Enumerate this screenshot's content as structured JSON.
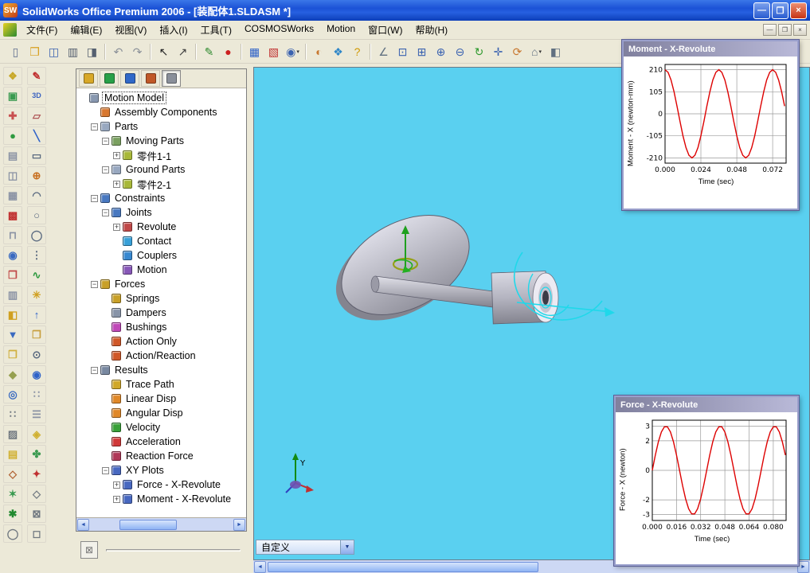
{
  "colors": {
    "viewport-bg": "#5ad0f0",
    "curve": "#dd0000",
    "titlebar-blue": "#1b52d6",
    "xp-beige": "#ece9d8"
  },
  "window": {
    "title": "SolidWorks Office Premium 2006 - [装配体1.SLDASM *]",
    "logo": "SW",
    "buttons": [
      {
        "name": "minimize",
        "glyph": "—"
      },
      {
        "name": "restore",
        "glyph": "❐"
      },
      {
        "name": "close",
        "glyph": "×"
      }
    ]
  },
  "menubar": {
    "items": [
      "文件(F)",
      "编辑(E)",
      "视图(V)",
      "插入(I)",
      "工具(T)",
      "COSMOSWorks",
      "Motion",
      "窗口(W)",
      "帮助(H)"
    ],
    "window_buttons": [
      {
        "name": "mdi-minimize",
        "glyph": "—"
      },
      {
        "name": "mdi-restore",
        "glyph": "❐"
      },
      {
        "name": "mdi-close",
        "glyph": "×"
      }
    ]
  },
  "toolbar": {
    "items": [
      {
        "name": "new-document",
        "glyph": "▯",
        "color": "#607090"
      },
      {
        "name": "open-document",
        "glyph": "❒",
        "color": "#d8a020"
      },
      {
        "name": "save",
        "glyph": "◫",
        "color": "#3a62b0"
      },
      {
        "name": "print",
        "glyph": "▥",
        "color": "#556070"
      },
      {
        "name": "print-preview",
        "glyph": "◨",
        "color": "#556070"
      },
      {
        "sep": true
      },
      {
        "name": "undo",
        "glyph": "↶",
        "color": "#8a9098"
      },
      {
        "name": "redo",
        "glyph": "↷",
        "color": "#8a9098"
      },
      {
        "sep": true
      },
      {
        "name": "select",
        "glyph": "↖",
        "color": "#202020"
      },
      {
        "name": "select-other",
        "glyph": "↗",
        "color": "#404040"
      },
      {
        "sep": true
      },
      {
        "name": "sketch",
        "glyph": "✎",
        "color": "#2e8a2e"
      },
      {
        "name": "sketch-point",
        "glyph": "●",
        "color": "#cc2020"
      },
      {
        "sep": true
      },
      {
        "name": "grid",
        "glyph": "▦",
        "color": "#2e62c8"
      },
      {
        "name": "options-panel",
        "glyph": "▧",
        "color": "#c03030"
      },
      {
        "name": "view-orientation",
        "glyph": "◉",
        "color": "#3a62b0",
        "dropdown": true
      },
      {
        "sep": true
      },
      {
        "name": "screen-capture",
        "glyph": "◐",
        "color": "#c87830"
      },
      {
        "name": "assembly-tools",
        "glyph": "❖",
        "color": "#2e86c8"
      },
      {
        "name": "help",
        "glyph": "?",
        "color": "#d09800"
      },
      {
        "sep": true
      },
      {
        "name": "measure",
        "glyph": "∠",
        "color": "#607080"
      },
      {
        "name": "zoom-to-fit",
        "glyph": "⊡",
        "color": "#3a62b0"
      },
      {
        "name": "zoom-to-area",
        "glyph": "⊞",
        "color": "#3a62b0"
      },
      {
        "name": "zoom-in-out",
        "glyph": "⊕",
        "color": "#3a62b0"
      },
      {
        "name": "zoom-out",
        "glyph": "⊖",
        "color": "#3a62b0"
      },
      {
        "name": "refresh-view",
        "glyph": "↻",
        "color": "#2e9a2e"
      },
      {
        "name": "pan",
        "glyph": "✛",
        "color": "#3a62b0"
      },
      {
        "name": "rotate-view",
        "glyph": "⟳",
        "color": "#c87830"
      },
      {
        "name": "standard-views",
        "glyph": "⌂",
        "color": "#607080",
        "dropdown": true
      },
      {
        "name": "display-style",
        "glyph": "◧",
        "color": "#607080"
      }
    ]
  },
  "left_toolbar_a": {
    "items": [
      {
        "name": "assembly-tool-1",
        "glyph": "❖",
        "color": "#c8a828"
      },
      {
        "name": "assembly-tool-2",
        "glyph": "▣",
        "color": "#3a9a50"
      },
      {
        "name": "assembly-tool-3",
        "glyph": "✚",
        "color": "#c85050"
      },
      {
        "name": "assembly-tool-4",
        "glyph": "●",
        "color": "#2f9a40"
      },
      {
        "name": "assembly-tool-5",
        "glyph": "▤",
        "color": "#8a92a4"
      },
      {
        "name": "assembly-tool-6",
        "glyph": "◫",
        "color": "#8a92a4"
      },
      {
        "name": "assembly-tool-7",
        "glyph": "▦",
        "color": "#8a92a4"
      },
      {
        "name": "assembly-tool-8",
        "glyph": "▩",
        "color": "#c03030"
      },
      {
        "name": "assembly-tool-9",
        "glyph": "⊓",
        "color": "#8a92a4"
      },
      {
        "name": "assembly-tool-10",
        "glyph": "◉",
        "color": "#3a6ac0"
      },
      {
        "name": "assembly-tool-11",
        "glyph": "❐",
        "color": "#c04848"
      },
      {
        "name": "assembly-tool-12",
        "glyph": "▥",
        "color": "#8a92a4"
      },
      {
        "name": "assembly-tool-13",
        "glyph": "◧",
        "color": "#d0a020"
      },
      {
        "name": "assembly-tool-14",
        "glyph": "▼",
        "color": "#3a6ac0"
      },
      {
        "name": "assembly-tool-15",
        "glyph": "❒",
        "color": "#d0b040"
      },
      {
        "name": "assembly-tool-16",
        "glyph": "◆",
        "color": "#96a050"
      },
      {
        "name": "assembly-tool-17",
        "glyph": "◎",
        "color": "#3a6ac0"
      },
      {
        "name": "assembly-tool-18",
        "glyph": "∷",
        "color": "#707880"
      },
      {
        "name": "assembly-tool-19",
        "glyph": "▨",
        "color": "#707880"
      },
      {
        "name": "assembly-tool-20",
        "glyph": "▤",
        "color": "#d0b030"
      },
      {
        "name": "assembly-tool-21",
        "glyph": "◇",
        "color": "#b06030"
      },
      {
        "name": "assembly-tool-22",
        "glyph": "✶",
        "color": "#3a9a50"
      },
      {
        "name": "assembly-tool-23",
        "glyph": "✱",
        "color": "#228a30"
      },
      {
        "name": "assembly-tool-24",
        "glyph": "◯",
        "color": "#707880"
      }
    ]
  },
  "left_toolbar_b": {
    "items": [
      {
        "name": "sketch-tool-1",
        "glyph": "✎",
        "color": "#c03030"
      },
      {
        "name": "sketch-tool-2",
        "glyph": "3D",
        "color": "#3a62c0"
      },
      {
        "name": "sketch-tool-3",
        "glyph": "▱",
        "color": "#b05858"
      },
      {
        "name": "sketch-tool-4",
        "glyph": "╲",
        "color": "#2e62c8"
      },
      {
        "name": "sketch-tool-5",
        "glyph": "▭",
        "color": "#5a6a80"
      },
      {
        "name": "sketch-tool-6",
        "glyph": "⊕",
        "color": "#c87020"
      },
      {
        "name": "sketch-tool-7",
        "glyph": "◠",
        "color": "#5a6a80"
      },
      {
        "name": "sketch-tool-8",
        "glyph": "○",
        "color": "#5a6a80"
      },
      {
        "name": "sketch-tool-9",
        "glyph": "◯",
        "color": "#5a6a80"
      },
      {
        "name": "sketch-tool-10",
        "glyph": "⋮",
        "color": "#5a6a80"
      },
      {
        "name": "sketch-tool-11",
        "glyph": "∿",
        "color": "#2f9a40"
      },
      {
        "name": "sketch-tool-12",
        "glyph": "✳",
        "color": "#d0a020"
      },
      {
        "name": "sketch-tool-13",
        "glyph": "↑",
        "color": "#2e62c8"
      },
      {
        "name": "sketch-tool-14",
        "glyph": "❒",
        "color": "#c8a040"
      },
      {
        "name": "sketch-tool-15",
        "glyph": "⊙",
        "color": "#5a6a80"
      },
      {
        "name": "sketch-tool-16",
        "glyph": "◉",
        "color": "#2e62c8"
      },
      {
        "name": "sketch-tool-17",
        "glyph": "∷",
        "color": "#8a92a4"
      },
      {
        "name": "sketch-tool-18",
        "glyph": "☰",
        "color": "#8a92a4"
      },
      {
        "name": "sketch-tool-19",
        "glyph": "◈",
        "color": "#d0b030"
      },
      {
        "name": "sketch-tool-20",
        "glyph": "✤",
        "color": "#3a9a50"
      },
      {
        "name": "sketch-tool-21",
        "glyph": "✦",
        "color": "#c03030"
      },
      {
        "name": "sketch-tool-22",
        "glyph": "◇",
        "color": "#707880"
      },
      {
        "name": "sketch-tool-23",
        "glyph": "⊠",
        "color": "#707880"
      },
      {
        "name": "sketch-tool-24",
        "glyph": "◻",
        "color": "#707880"
      }
    ]
  },
  "tree": {
    "tabs": [
      {
        "name": "featuremanager",
        "color": "#d8a828"
      },
      {
        "name": "propertymanager",
        "color": "#28a048"
      },
      {
        "name": "configurationmanager",
        "color": "#3068c8"
      },
      {
        "name": "cosmos",
        "color": "#c05828"
      },
      {
        "name": "motionmanager",
        "color": "#8a8f9a",
        "selected": true
      }
    ],
    "items": [
      {
        "label": "Motion Model",
        "depth": 0,
        "expand": "none",
        "icon": "motion-model",
        "color": "#8898b0",
        "selected": true
      },
      {
        "label": "Assembly Components",
        "depth": 1,
        "expand": "none",
        "icon": "assembly-components",
        "color": "#d87830"
      },
      {
        "label": "Parts",
        "depth": 1,
        "expand": "minus",
        "icon": "parts",
        "color": "#98a8c0"
      },
      {
        "label": "Moving Parts",
        "depth": 2,
        "expand": "minus",
        "icon": "moving-parts",
        "color": "#7aa060"
      },
      {
        "label": "零件1-1",
        "depth": 3,
        "expand": "plus",
        "icon": "part",
        "color": "#a8b838"
      },
      {
        "label": "Ground Parts",
        "depth": 2,
        "expand": "minus",
        "icon": "ground-parts",
        "color": "#98a8c0"
      },
      {
        "label": "零件2-1",
        "depth": 3,
        "expand": "plus",
        "icon": "part",
        "color": "#a8b838"
      },
      {
        "label": "Constraints",
        "depth": 1,
        "expand": "minus",
        "icon": "constraints",
        "color": "#4878c0"
      },
      {
        "label": "Joints",
        "depth": 2,
        "expand": "minus",
        "icon": "joints",
        "color": "#4878c0"
      },
      {
        "label": "Revolute",
        "depth": 3,
        "expand": "plus",
        "icon": "revolute",
        "color": "#c04848"
      },
      {
        "label": "Contact",
        "depth": 3,
        "expand": "none",
        "icon": "contact",
        "color": "#38a0d8"
      },
      {
        "label": "Couplers",
        "depth": 3,
        "expand": "none",
        "icon": "couplers",
        "color": "#3888d0"
      },
      {
        "label": "Motion",
        "depth": 3,
        "expand": "none",
        "icon": "motion-constraint",
        "color": "#8858b8"
      },
      {
        "label": "Forces",
        "depth": 1,
        "expand": "minus",
        "icon": "forces",
        "color": "#c8a028"
      },
      {
        "label": "Springs",
        "depth": 2,
        "expand": "none",
        "icon": "springs",
        "color": "#c8a028"
      },
      {
        "label": "Dampers",
        "depth": 2,
        "expand": "none",
        "icon": "dampers",
        "color": "#8894a8"
      },
      {
        "label": "Bushings",
        "depth": 2,
        "expand": "none",
        "icon": "bushings",
        "color": "#c048b8"
      },
      {
        "label": "Action Only",
        "depth": 2,
        "expand": "none",
        "icon": "action-only",
        "color": "#d05828"
      },
      {
        "label": "Action/Reaction",
        "depth": 2,
        "expand": "none",
        "icon": "action-reaction",
        "color": "#d05828"
      },
      {
        "label": "Results",
        "depth": 1,
        "expand": "minus",
        "icon": "results",
        "color": "#7888a0"
      },
      {
        "label": "Trace Path",
        "depth": 2,
        "expand": "none",
        "icon": "trace-path",
        "color": "#d0a828"
      },
      {
        "label": "Linear Disp",
        "depth": 2,
        "expand": "none",
        "icon": "linear-disp",
        "color": "#e08828"
      },
      {
        "label": "Angular Disp",
        "depth": 2,
        "expand": "none",
        "icon": "angular-disp",
        "color": "#e08828"
      },
      {
        "label": "Velocity",
        "depth": 2,
        "expand": "none",
        "icon": "velocity",
        "color": "#38a038"
      },
      {
        "label": "Acceleration",
        "depth": 2,
        "expand": "none",
        "icon": "acceleration",
        "color": "#d03838"
      },
      {
        "label": "Reaction Force",
        "depth": 2,
        "expand": "none",
        "icon": "reaction-force",
        "color": "#b03858"
      },
      {
        "label": "XY Plots",
        "depth": 2,
        "expand": "minus",
        "icon": "xy-plots",
        "color": "#4868c0"
      },
      {
        "label": "Force - X-Revolute",
        "depth": 3,
        "expand": "plus",
        "icon": "plot",
        "color": "#4868c0"
      },
      {
        "label": "Moment - X-Revolute",
        "depth": 3,
        "expand": "plus",
        "icon": "plot",
        "color": "#4868c0"
      }
    ]
  },
  "viewport": {
    "combo_value": "自定义",
    "combo_arrow": "▼",
    "triad_label": "Y"
  },
  "scroll": {
    "left_arrow": "◄",
    "right_arrow": "►"
  },
  "chart_data": [
    {
      "type": "line",
      "title": "Moment - X-Revolute",
      "ylabel": "Moment - X (newton-mm)",
      "xlabel": "Time (sec)",
      "yticks": [
        210,
        105,
        0,
        -105,
        -210
      ],
      "xticks": [
        0,
        0.024,
        0.048,
        0.072
      ],
      "ylim": [
        -235,
        235
      ],
      "xlim": [
        0,
        0.081
      ],
      "grid": true,
      "legend": false,
      "series": [
        {
          "name": "Moment - X",
          "color": "#dd0000",
          "x_start": 0,
          "x_step": 0.002,
          "y": [
            210,
            197.3,
            160.9,
            105,
            36.5,
            -36.5,
            -105,
            -160.9,
            -197.3,
            -210,
            -197.3,
            -160.9,
            -105,
            -36.5,
            36.5,
            105,
            160.9,
            197.3,
            210,
            197.3,
            160.9,
            105,
            36.5,
            -36.5,
            -105,
            -160.9,
            -197.3,
            -210,
            -197.3,
            -160.9,
            -105,
            -36.5,
            36.5,
            105,
            160.9,
            197.3,
            210,
            197.3,
            160.9,
            105,
            36.5
          ]
        }
      ]
    },
    {
      "type": "line",
      "title": "Force - X-Revolute",
      "ylabel": "Force - X (newton)",
      "xlabel": "Time (sec)",
      "yticks": [
        3,
        2,
        0,
        -2,
        -3
      ],
      "xticks": [
        0,
        0.016,
        0.032,
        0.048,
        0.064,
        0.08
      ],
      "ylim": [
        -3.4,
        3.4
      ],
      "xlim": [
        0,
        0.0885
      ],
      "grid": true,
      "legend": false,
      "series": [
        {
          "name": "Force - X",
          "color": "#dd0000",
          "x_start": 0,
          "x_step": 0.002,
          "y": [
            0,
            1.03,
            1.93,
            2.6,
            2.95,
            2.95,
            2.6,
            1.93,
            1.03,
            0,
            -1.03,
            -1.93,
            -2.6,
            -2.95,
            -2.95,
            -2.6,
            -1.93,
            -1.03,
            0,
            1.03,
            1.93,
            2.6,
            2.95,
            2.95,
            2.6,
            1.93,
            1.03,
            0,
            -1.03,
            -1.93,
            -2.6,
            -2.95,
            -2.95,
            -2.6,
            -1.93,
            -1.03,
            0,
            1.03,
            1.93,
            2.6,
            2.95,
            2.95,
            2.6,
            1.93,
            1.03
          ]
        }
      ]
    }
  ]
}
